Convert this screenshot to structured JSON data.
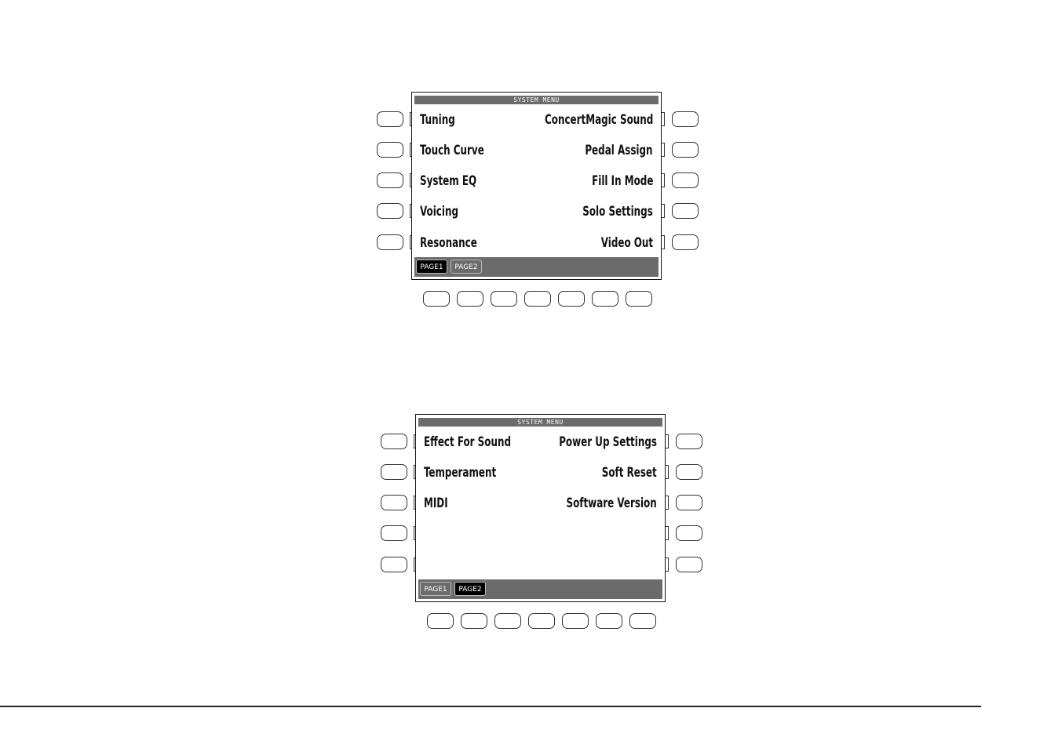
{
  "screens": [
    {
      "title": "SYSTEM MENU",
      "left_items": [
        "Tuning",
        "Touch Curve",
        "System EQ",
        "Voicing",
        "Resonance"
      ],
      "right_items": [
        "ConcertMagic Sound",
        "Pedal Assign",
        "Fill In Mode",
        "Solo Settings",
        "Video Out"
      ],
      "tabs": [
        {
          "label": "PAGE1",
          "active": true
        },
        {
          "label": "PAGE2",
          "active": false
        }
      ]
    },
    {
      "title": "SYSTEM MENU",
      "left_items": [
        "Effect For Sound",
        "Temperament",
        "MIDI",
        "",
        ""
      ],
      "right_items": [
        "Power Up Settings",
        "Soft Reset",
        "Software Version",
        "",
        ""
      ],
      "tabs": [
        {
          "label": "PAGE1",
          "active": false
        },
        {
          "label": "PAGE2",
          "active": true
        }
      ]
    }
  ],
  "colors": {
    "bar": "#6b6b6b",
    "active_tab": "#000000",
    "text": "#111111"
  }
}
